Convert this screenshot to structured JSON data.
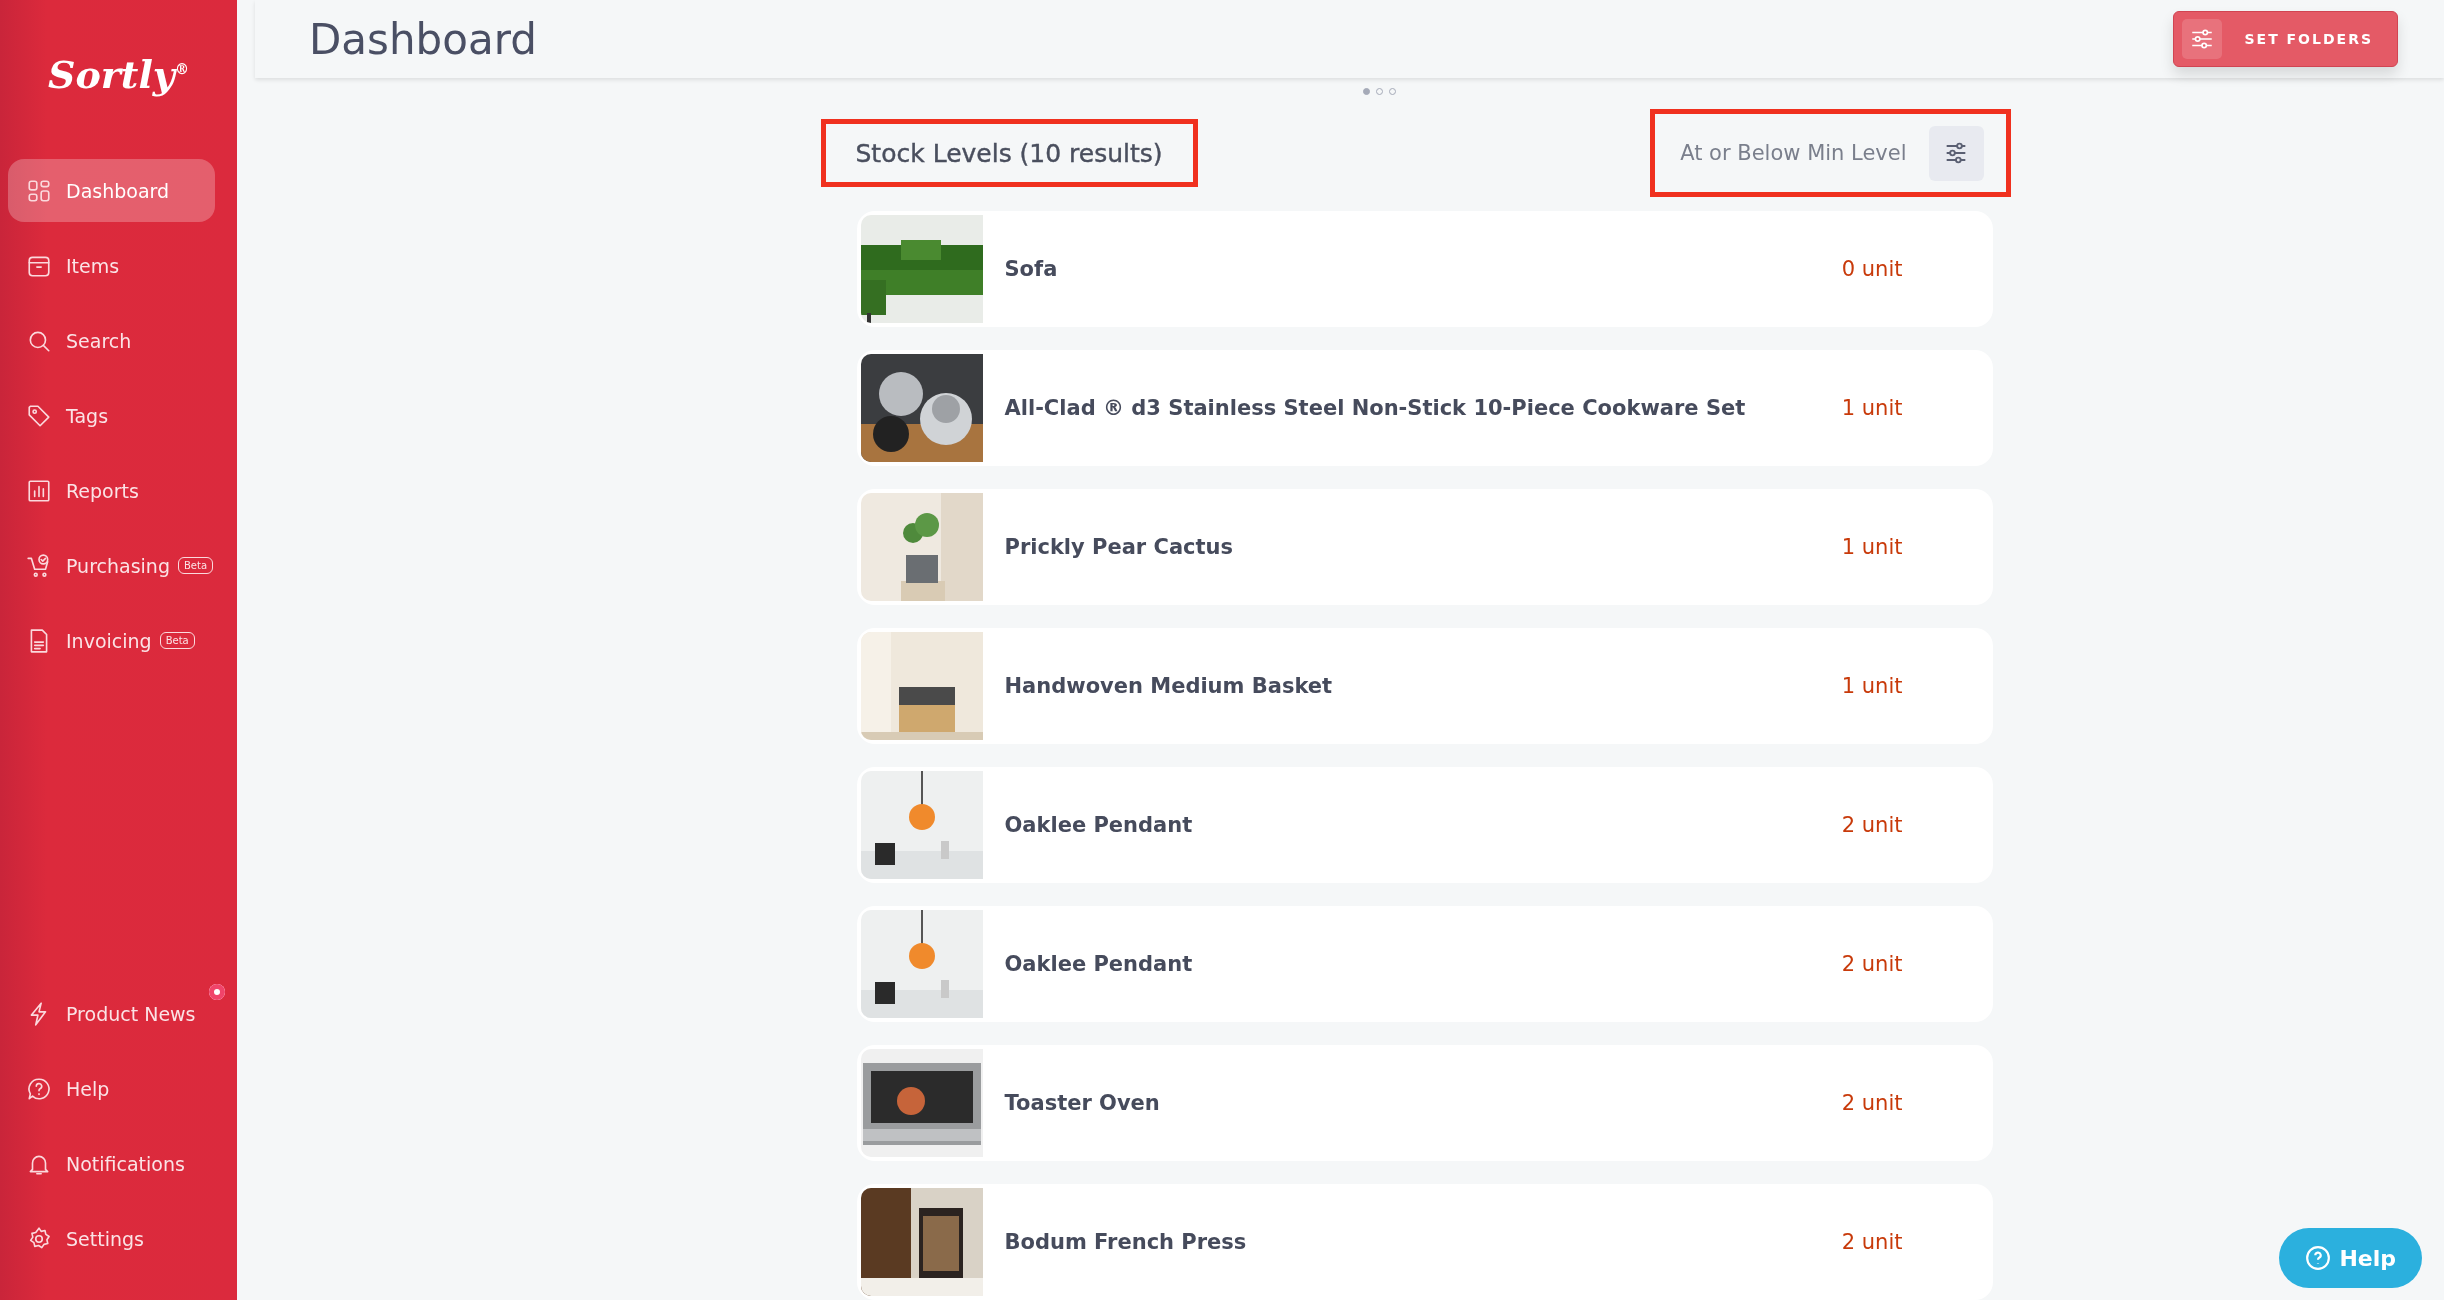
{
  "sidebar": {
    "logo": "Sortly",
    "logo_mark": "®",
    "items": [
      {
        "label": "Dashboard",
        "kind": "grid",
        "selected": true
      },
      {
        "label": "Items",
        "kind": "box",
        "selected": false
      },
      {
        "label": "Search",
        "kind": "search",
        "selected": false
      },
      {
        "label": "Tags",
        "kind": "tag",
        "selected": false
      },
      {
        "label": "Reports",
        "kind": "chart",
        "selected": false
      },
      {
        "label": "Purchasing",
        "kind": "cart",
        "badge": "Beta",
        "selected": false
      },
      {
        "label": "Invoicing",
        "kind": "invoice",
        "badge": "Beta",
        "selected": false
      }
    ],
    "bottom_items": [
      {
        "label": "Product News",
        "kind": "bolt",
        "dot": true
      },
      {
        "label": "Help",
        "kind": "help",
        "dot": false
      },
      {
        "label": "Notifications",
        "kind": "bell",
        "dot": false
      },
      {
        "label": "Settings",
        "kind": "gear",
        "dot": false
      }
    ]
  },
  "header": {
    "title": "Dashboard",
    "button": "SET FOLDERS"
  },
  "pager": [
    {
      "selected": true
    },
    {
      "selected": false
    },
    {
      "selected": false
    }
  ],
  "widget": {
    "title": "Stock Levels (10 results)",
    "title_highlighted": true,
    "filter": "At or Below Min Level",
    "filter_highlighted": true,
    "rows": [
      {
        "name": "Sofa",
        "quantity": "0 unit"
      },
      {
        "name": "All-Clad ® d3 Stainless Steel Non-Stick 10-Piece Cookware Set",
        "quantity": "1 unit"
      },
      {
        "name": "Prickly Pear Cactus",
        "quantity": "1 unit"
      },
      {
        "name": "Handwoven Medium Basket",
        "quantity": "1 unit"
      },
      {
        "name": "Oaklee Pendant",
        "quantity": "2 unit"
      },
      {
        "name": "Oaklee Pendant",
        "quantity": "2 unit"
      },
      {
        "name": "Toaster Oven",
        "quantity": "2 unit"
      },
      {
        "name": "Bodum French Press",
        "quantity": "2 unit"
      }
    ]
  },
  "help_button": "Help"
}
